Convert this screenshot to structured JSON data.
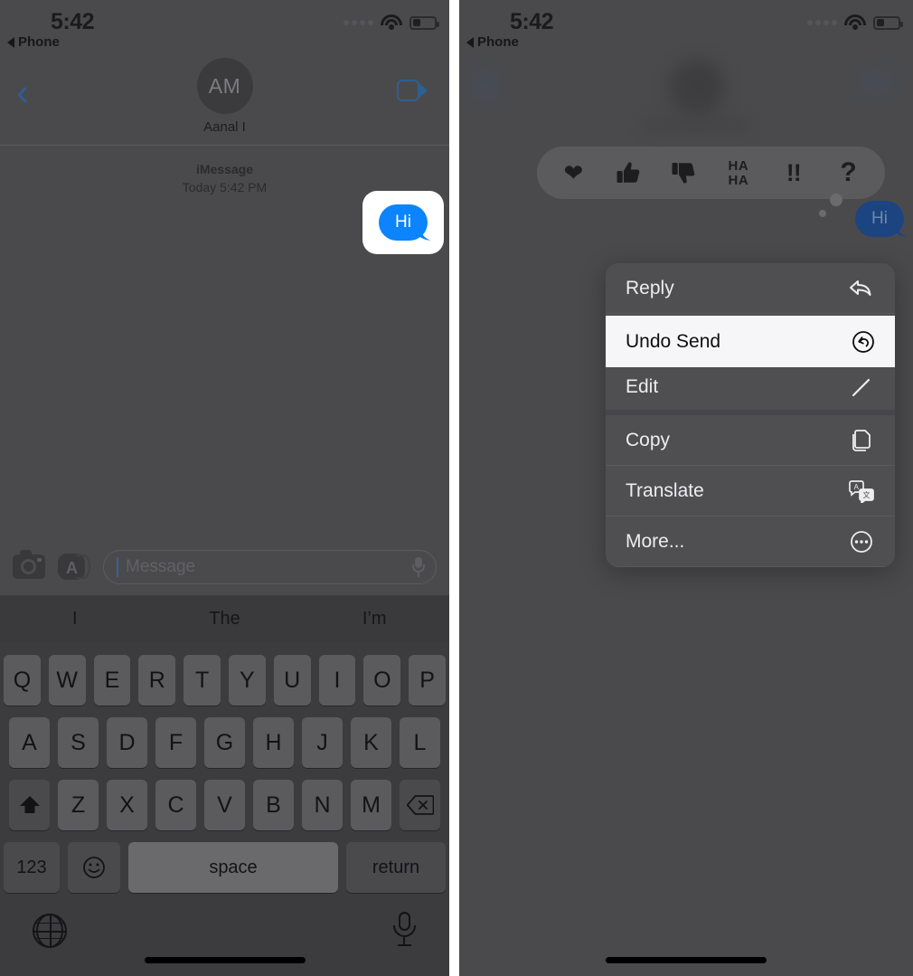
{
  "meta": {
    "app": "Messages",
    "accent_blue": "#0b84fe",
    "tint_blue": "#2e5f92",
    "panel_bg": "#4a4a4c",
    "highlight_bg": "#f6f6f8"
  },
  "status_bar": {
    "time": "5:42",
    "back_app_label": "Phone",
    "back_app_icon": "triangle-left-icon",
    "signal_icon": "signal-dots-icon",
    "wifi_icon": "wifi-icon",
    "battery_icon": "battery-low-icon"
  },
  "nav_bar": {
    "back_icon": "chevron-left-icon",
    "avatar_initials": "AM",
    "contact_name": "Aanal I",
    "facetime_icon": "video-camera-icon"
  },
  "conversation": {
    "service_label": "iMessage",
    "timestamp": "Today 5:42 PM",
    "message": {
      "text": "Hi",
      "sender": "me",
      "highlighted": true
    }
  },
  "input_bar": {
    "camera_icon": "camera-icon",
    "apps_icon": "app-store-icon",
    "placeholder": "Message",
    "mic_icon": "microphone-icon"
  },
  "keyboard": {
    "suggestions": [
      "I",
      "The",
      "I’m"
    ],
    "row1": [
      "Q",
      "W",
      "E",
      "R",
      "T",
      "Y",
      "U",
      "I",
      "O",
      "P"
    ],
    "row2": [
      "A",
      "S",
      "D",
      "F",
      "G",
      "H",
      "J",
      "K",
      "L"
    ],
    "row3": [
      "Z",
      "X",
      "C",
      "V",
      "B",
      "N",
      "M"
    ],
    "shift_icon": "shift-up-icon",
    "delete_icon": "backspace-icon",
    "numbers_label": "123",
    "emoji_icon": "smiley-icon",
    "space_label": "space",
    "return_label": "return",
    "globe_icon": "globe-icon",
    "dictation_icon": "microphone-icon"
  },
  "tapbacks": [
    {
      "name": "heart",
      "glyph": "♥",
      "label": "Love"
    },
    {
      "name": "thumbs-up",
      "glyph": "👍",
      "label": "Like"
    },
    {
      "name": "thumbs-down",
      "glyph": "👎",
      "label": "Dislike"
    },
    {
      "name": "haha",
      "glyph": "HA HA",
      "label": "Haha"
    },
    {
      "name": "exclamation",
      "glyph": "!!",
      "label": "Emphasize"
    },
    {
      "name": "question",
      "glyph": "?",
      "label": "Question"
    }
  ],
  "context_menu": {
    "items": [
      {
        "label": "Reply",
        "icon": "reply-arrow-icon",
        "highlighted": false
      },
      {
        "label": "Undo Send",
        "icon": "undo-circle-icon",
        "highlighted": true
      },
      {
        "label": "Edit",
        "icon": "pencil-icon",
        "highlighted": false
      },
      {
        "label": "Copy",
        "icon": "copy-pages-icon",
        "highlighted": false
      },
      {
        "label": "Translate",
        "icon": "translate-icon",
        "highlighted": false
      },
      {
        "label": "More...",
        "icon": "ellipsis-circle-icon",
        "highlighted": false
      }
    ]
  },
  "right_panel": {
    "status_bar": {
      "time": "5:42",
      "back_app_label": "Phone"
    },
    "message": {
      "text": "Hi"
    }
  }
}
